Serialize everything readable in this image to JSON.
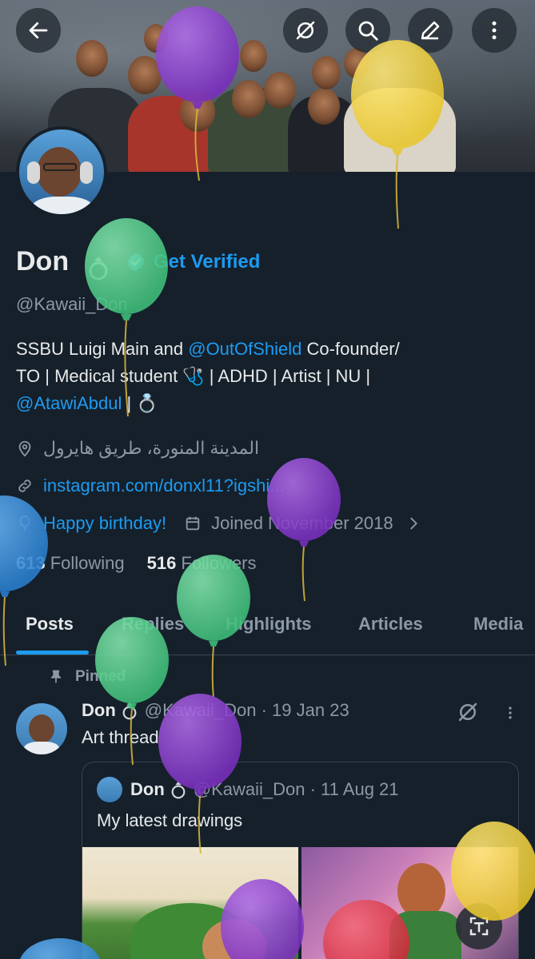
{
  "profile": {
    "name": "Don",
    "get_verified": "Get Verified",
    "handle": "@Kawaii_Don",
    "bio": {
      "part1": "SSBU Luigi Main and ",
      "mention1": "@OutOfShield",
      "part2": " Co-founder/",
      "part3": "TO | Medical student 🩺 | ADHD | Artist | NU |",
      "mention2": "@AtawiAbdul",
      "part4": " | 💍"
    },
    "location": "المدينة المنورة، طريق هايرول",
    "website": "instagram.com/donxl11?igshi...",
    "birthday": "Happy birthday!",
    "joined": "Joined November 2018",
    "following_count": "613",
    "following_label": "Following",
    "followers_count": "516",
    "followers_label": "Followers"
  },
  "tabs": [
    "Posts",
    "Replies",
    "Highlights",
    "Articles",
    "Media"
  ],
  "post": {
    "pinned_label": "Pinned",
    "name": "Don",
    "handle_date": "@Kawaii_Don · 19 Jan 23",
    "text": "Art thread",
    "quote": {
      "name": "Don",
      "handle_date": "@Kawaii_Don · 11 Aug 21",
      "text": "My latest drawings"
    }
  },
  "icons": {
    "back": "arrow-left-icon",
    "grok": "grok-icon",
    "search": "search-icon",
    "edit": "pencil-icon",
    "more": "more-vertical-icon",
    "translate": "translate-icon"
  },
  "colors": {
    "background": "#15202b",
    "accent": "#1d9bf0",
    "muted": "#8b98a5",
    "balloon_purple": "#8e3fcf",
    "balloon_yellow": "#f2d23c",
    "balloon_green": "#4fd18a",
    "balloon_blue": "#2d8de0",
    "balloon_red": "#e0394a"
  }
}
